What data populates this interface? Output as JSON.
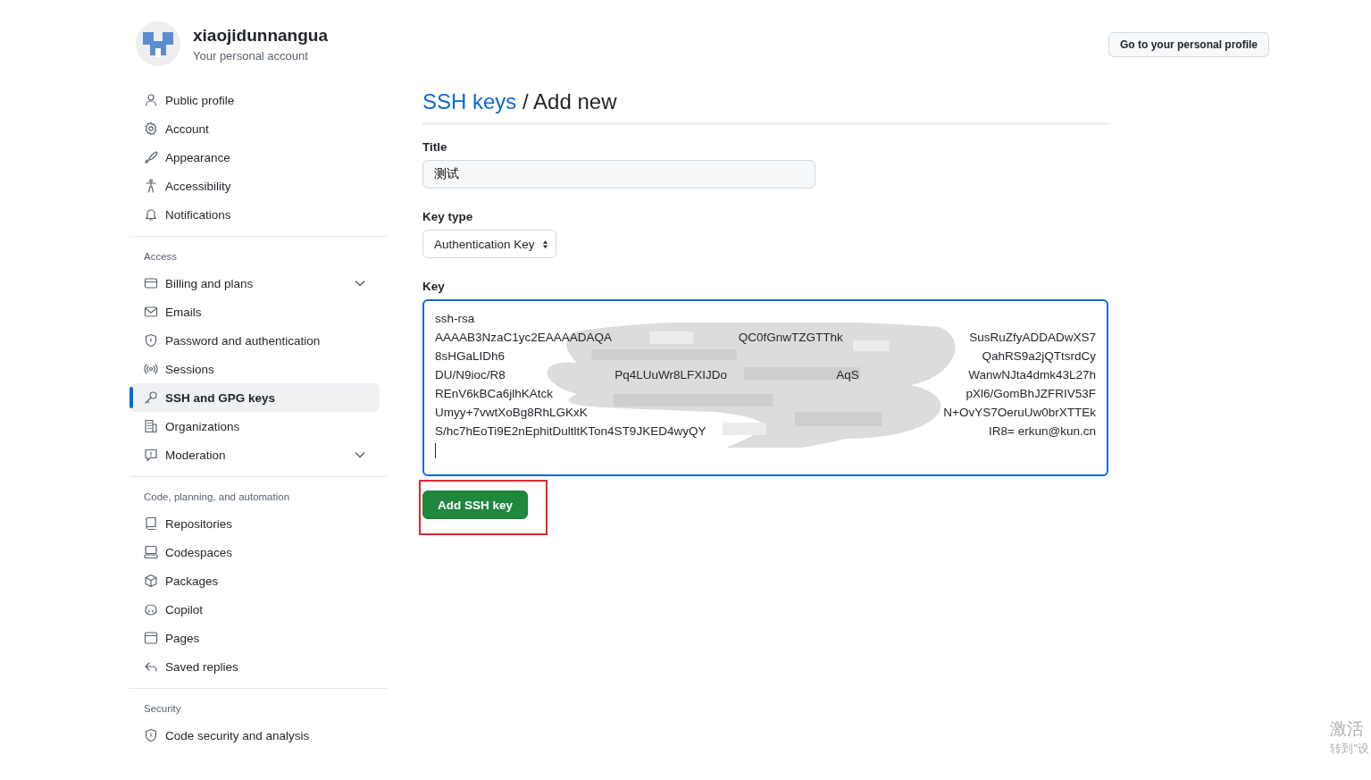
{
  "account": {
    "name": "xiaojidunnangua",
    "subtitle": "Your personal account",
    "profile_button": "Go to your personal profile"
  },
  "sidebar": {
    "sections": [
      {
        "items": [
          {
            "label": "Public profile",
            "selected": false
          },
          {
            "label": "Account",
            "selected": false
          },
          {
            "label": "Appearance",
            "selected": false
          },
          {
            "label": "Accessibility",
            "selected": false
          },
          {
            "label": "Notifications",
            "selected": false
          }
        ]
      },
      {
        "heading": "Access",
        "items": [
          {
            "label": "Billing and plans",
            "selected": false,
            "expandable": true
          },
          {
            "label": "Emails",
            "selected": false
          },
          {
            "label": "Password and authentication",
            "selected": false
          },
          {
            "label": "Sessions",
            "selected": false
          },
          {
            "label": "SSH and GPG keys",
            "selected": true
          },
          {
            "label": "Organizations",
            "selected": false
          },
          {
            "label": "Moderation",
            "selected": false,
            "expandable": true
          }
        ]
      },
      {
        "heading": "Code, planning, and automation",
        "items": [
          {
            "label": "Repositories",
            "selected": false
          },
          {
            "label": "Codespaces",
            "selected": false
          },
          {
            "label": "Packages",
            "selected": false
          },
          {
            "label": "Copilot",
            "selected": false
          },
          {
            "label": "Pages",
            "selected": false
          },
          {
            "label": "Saved replies",
            "selected": false
          }
        ]
      },
      {
        "heading": "Security",
        "items": [
          {
            "label": "Code security and analysis",
            "selected": false
          }
        ]
      }
    ]
  },
  "heading": {
    "link": "SSH keys",
    "rest": "/ Add new"
  },
  "form": {
    "title_label": "Title",
    "title_value": "测试",
    "key_type_label": "Key type",
    "key_type_value": "Authentication Key",
    "key_label": "Key",
    "key_lines": [
      [
        "ssh-rsa"
      ],
      [
        "AAAAB3NzaC1yc2EAAAADAQA",
        "QC0fGnwTZGTThk",
        "SusRuZfyADDADwXS7"
      ],
      [
        "8sHGaLIDh6",
        "QahRS9a2jQTtsrdCy"
      ],
      [
        "DU/N9ioc/R8",
        "Pq4LUuWr8LFXIJDo",
        "AqS",
        "WanwNJta4dmk43L27h"
      ],
      [
        "REnV6kBCa6jlhKAtck",
        "pXl6/GomBhJZFRIV53F"
      ],
      [
        "Umyy+7vwtXoBg8RhLGKxK",
        "N+OvYS7OeruUw0brXTTEk"
      ],
      [
        "S/hc7hEoTi9E2nEphitDultltKTon4ST9JKED4wyQY",
        "IR8= erkun@kun.cn"
      ]
    ],
    "submit": "Add SSH key",
    "submit_highlighted": true
  },
  "os_notice": {
    "line1": "激活",
    "line2": "转到\"设"
  }
}
